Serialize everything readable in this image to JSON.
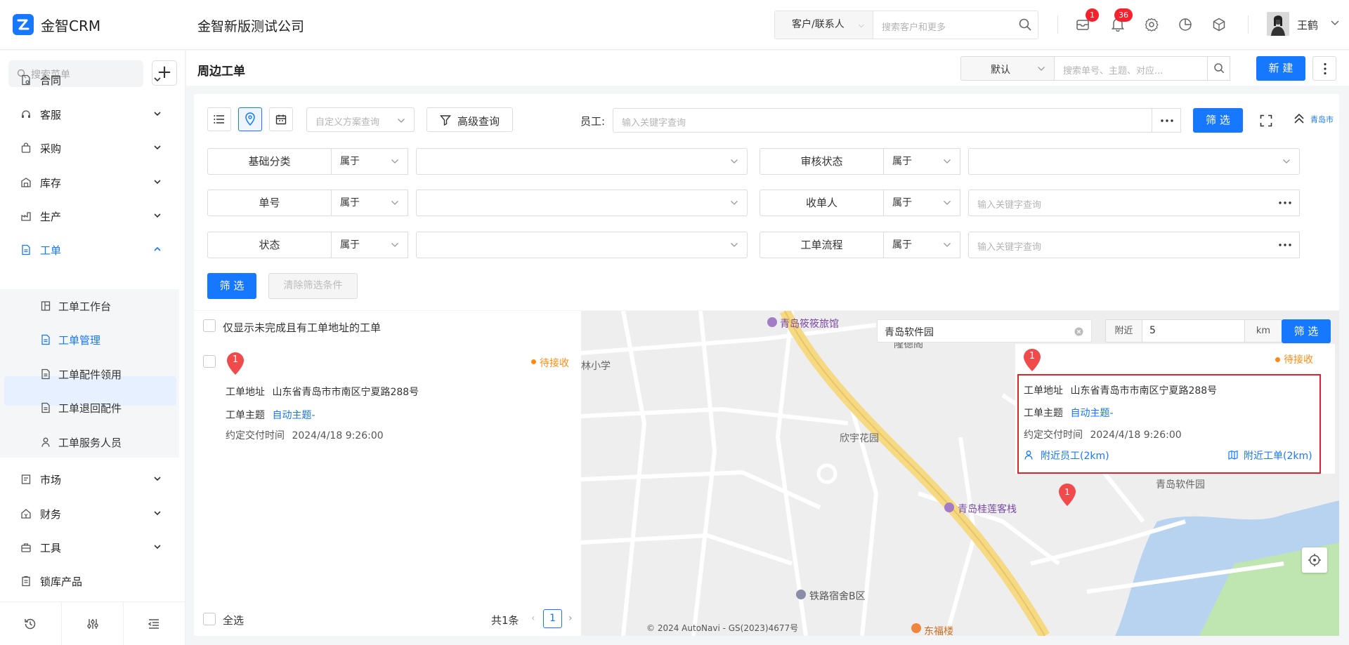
{
  "app": {
    "name": "金智CRM",
    "company": "金智新版测试公司"
  },
  "topbar": {
    "search_type": "客户/联系人",
    "search_placeholder": "搜索客户和更多",
    "msg_badge": "1",
    "notify_badge": "36",
    "user_name": "王鹤"
  },
  "sidebar": {
    "search_placeholder": "搜索菜单",
    "plus": "+",
    "items": [
      {
        "label": "合同"
      },
      {
        "label": "客服"
      },
      {
        "label": "采购"
      },
      {
        "label": "库存"
      },
      {
        "label": "生产"
      },
      {
        "label": "工单"
      },
      {
        "label": "市场"
      },
      {
        "label": "财务"
      },
      {
        "label": "工具"
      },
      {
        "label": "锁库产品"
      }
    ],
    "sub_items": [
      {
        "label": "工单工作台"
      },
      {
        "label": "工单管理"
      },
      {
        "label": "工单配件领用"
      },
      {
        "label": "工单退回配件"
      },
      {
        "label": "工单服务人员"
      }
    ]
  },
  "header": {
    "title": "周边工单",
    "view_select": "默认",
    "search_placeholder": "搜索单号、主题、对应...",
    "new_button": "新 建"
  },
  "filters": {
    "scheme_placeholder": "自定义方案查询",
    "advanced_label": "高级查询",
    "employee_label": "员工:",
    "employee_placeholder": "输入关键字查询",
    "filter_button": "筛 选",
    "city": "青岛市",
    "rows": [
      {
        "name": "基础分类",
        "op": "属于",
        "value": ""
      },
      {
        "name": "审核状态",
        "op": "属于",
        "value": ""
      },
      {
        "name": "单号",
        "op": "属于",
        "value": ""
      },
      {
        "name": "收单人",
        "op": "属于",
        "placeholder": "输入关键字查询"
      },
      {
        "name": "状态",
        "op": "属于",
        "value": ""
      },
      {
        "name": "工单流程",
        "op": "属于",
        "placeholder": "输入关键字查询"
      }
    ],
    "apply_button": "筛 选",
    "clear_button": "清除筛选条件"
  },
  "list": {
    "only_incomplete_label": "仅显示未完成且有工单地址的工单",
    "items": [
      {
        "pin": "1",
        "status": "待接收",
        "address_label": "工单地址",
        "address": "山东省青岛市市南区宁夏路288号",
        "subject_label": "工单主题",
        "subject": "自动主题-",
        "due_label": "约定交付时间",
        "due": "2024/4/18 9:26:00"
      }
    ],
    "select_all_label": "全选",
    "total_label": "共1条",
    "current_page": "1"
  },
  "map": {
    "search_value": "青岛软件园",
    "near_label": "附近",
    "near_value": "5",
    "unit": "km",
    "filter_button": "筛 选",
    "pois": [
      "青岛筱筱旅馆",
      "青岛桂莲客栈",
      "铁路宿舍B区",
      "东福楼"
    ],
    "labels": [
      "林小学",
      "欣宇花园",
      "青岛软件园",
      "隆德阁"
    ],
    "copyright": "© 2024 AutoNavi - GS(2023)4677号",
    "card": {
      "pin": "1",
      "status": "待接收",
      "address_label": "工单地址",
      "address": "山东省青岛市市南区宁夏路288号",
      "subject_label": "工单主题",
      "subject": "自动主题-",
      "due_label": "约定交付时间",
      "due": "2024/4/18 9:26:00",
      "nearby_staff": "附近员工(2km)",
      "nearby_orders": "附近工单(2km)"
    },
    "marker_pin": "1"
  },
  "colors": {
    "primary": "#1677ff",
    "warning": "#fa8c16",
    "danger": "#f5222d",
    "highlight": "#e0222b"
  }
}
